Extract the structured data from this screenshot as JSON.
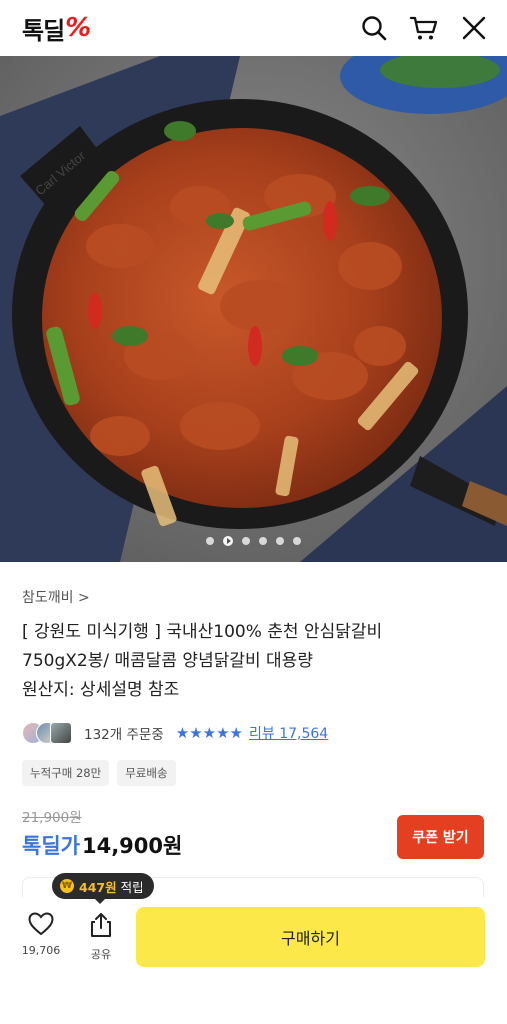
{
  "header": {
    "logo_text": "톡딜",
    "logo_mark": "%",
    "icons": [
      "search-icon",
      "cart-icon",
      "close-icon"
    ]
  },
  "hero": {
    "pan_brand": "Carl Victor",
    "carousel_dots": 6,
    "active_dot": 1
  },
  "product": {
    "brand": "참도깨비 >",
    "title_lines": [
      "[ 강원도 미식기행 ] 국내산100% 춘천 안심닭갈비",
      "750gX2봉/ 매콤달콤 양념닭갈비 대용량",
      "원산지: 상세설명 참조"
    ],
    "order_count": "132개 주문중",
    "rating_stars": "★★★★★",
    "review_label": "리뷰 17,564",
    "badges": [
      "누적구매 28만",
      "무료배송"
    ],
    "original_price": "21,900원",
    "price_label": "톡딜가",
    "price": "14,900원",
    "coupon_button": "쿠폰 받기"
  },
  "bottom_bar": {
    "points_amount": "447원",
    "points_suffix": "적립",
    "like_count": "19,706",
    "share_label": "공유",
    "buy_button": "구매하기"
  },
  "colors": {
    "accent_blue": "#3b74dd",
    "coupon_red": "#e43f21",
    "buy_yellow": "#fde84a",
    "logo_red": "#f01c1c"
  }
}
